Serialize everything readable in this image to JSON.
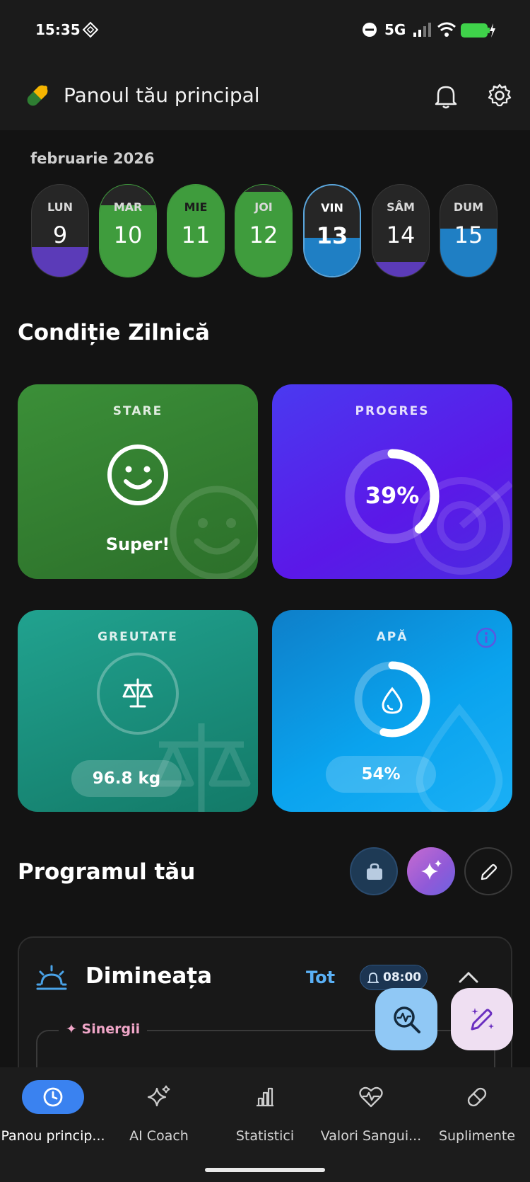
{
  "status": {
    "time": "15:35",
    "network": "5G"
  },
  "header": {
    "title": "Panoul tău principal"
  },
  "calendar": {
    "month": "februarie 2026",
    "days": [
      {
        "name": "LUN",
        "num": "9"
      },
      {
        "name": "MAR",
        "num": "10"
      },
      {
        "name": "MIE",
        "num": "11"
      },
      {
        "name": "JOI",
        "num": "12"
      },
      {
        "name": "VIN",
        "num": "13"
      },
      {
        "name": "SÂM",
        "num": "14"
      },
      {
        "name": "DUM",
        "num": "15"
      }
    ]
  },
  "daily": {
    "title": "Condiție Zilnică",
    "mood": {
      "title": "STARE",
      "value": "Super!"
    },
    "progress": {
      "title": "PROGRES",
      "value": "39%",
      "fraction": 0.39
    },
    "weight": {
      "title": "GREUTATE",
      "value": "96.8 kg"
    },
    "water": {
      "title": "APĂ",
      "value": "54%",
      "fraction": 0.54
    }
  },
  "program": {
    "title": "Programul tău",
    "morning": {
      "title": "Dimineața",
      "filter": "Tot",
      "time": "08:00"
    },
    "synergy": "Sinergii"
  },
  "nav": {
    "items": [
      {
        "label": "Panou princip..."
      },
      {
        "label": "AI Coach"
      },
      {
        "label": "Statistici"
      },
      {
        "label": "Valori Sangui..."
      },
      {
        "label": "Suplimente"
      }
    ]
  },
  "colors": {
    "green": "#3f9c3d",
    "purple": "#5a2fd1",
    "teal": "#1a9a88",
    "blue": "#0ea5e9",
    "accent": "#3b82f6"
  }
}
